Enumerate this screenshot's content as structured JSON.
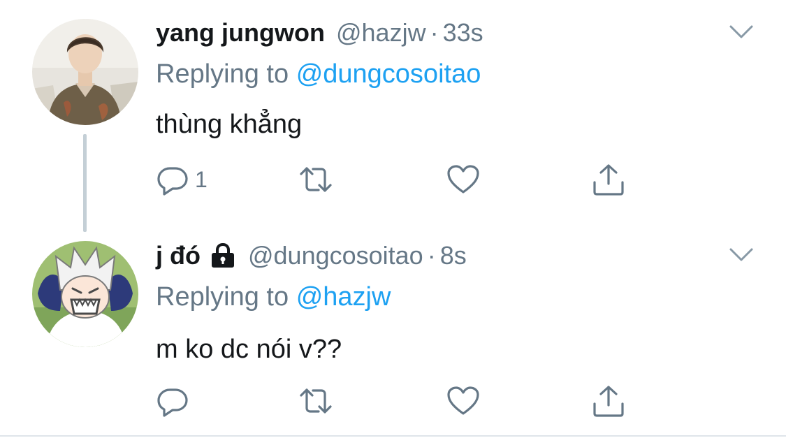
{
  "colors": {
    "text_primary": "#14171a",
    "text_secondary": "#657786",
    "link": "#1da1f2",
    "thread_line": "#c4cfd6"
  },
  "tweets": [
    {
      "name": "yang jungwon",
      "protected": false,
      "handle": "@hazjw",
      "separator": "·",
      "time": "33s",
      "replying_prefix": "Replying to",
      "replying_to": "@dungcosoitao",
      "text": "thùng khẳng",
      "reply_count": "1",
      "icons": [
        "reply-icon",
        "retweet-icon",
        "like-icon",
        "share-icon",
        "chevron-down-icon"
      ]
    },
    {
      "name": "j đó",
      "protected": true,
      "handle": "@dungcosoitao",
      "separator": "·",
      "time": "8s",
      "replying_prefix": "Replying to",
      "replying_to": "@hazjw",
      "text": "m ko dc nói v??",
      "reply_count": "",
      "icons": [
        "reply-icon",
        "retweet-icon",
        "like-icon",
        "share-icon",
        "chevron-down-icon",
        "lock-icon"
      ]
    }
  ]
}
